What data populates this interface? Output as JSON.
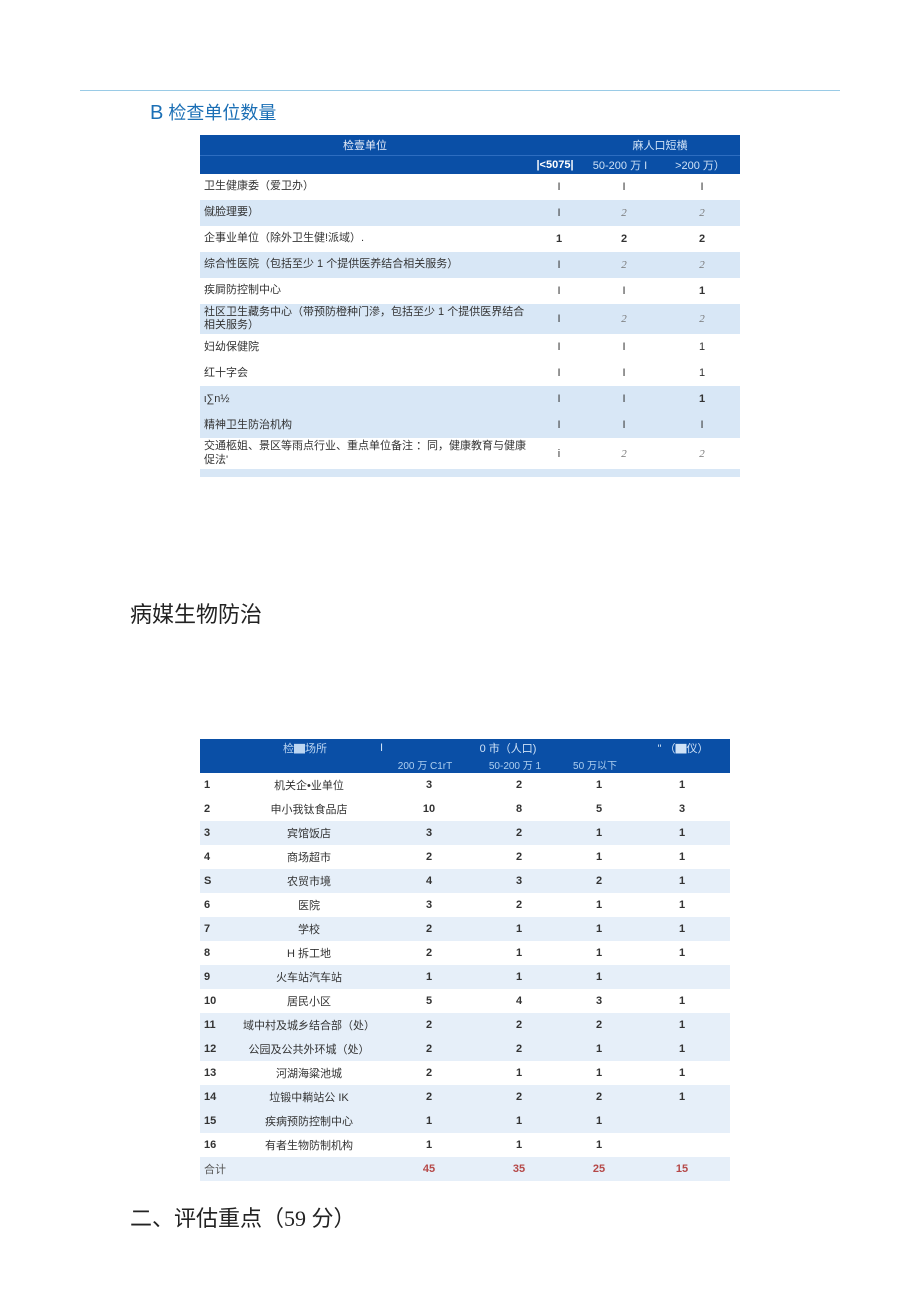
{
  "titleB": "检查单位数量",
  "titleBletter": "B",
  "table1": {
    "header": {
      "unit": "检壹单位",
      "pop": "麻人口短横",
      "c1": "|<5075|",
      "c2": "50-200 万 I",
      "c3": ">200 万）"
    },
    "rows": [
      {
        "name": "卫生健康委（爱卫办）",
        "c1": "I",
        "c2": "I",
        "c3": "I",
        "alt": false
      },
      {
        "name": "僦脸理要）",
        "c1": "I",
        "c2": "2",
        "c2i": true,
        "c3": "2",
        "c3i": true,
        "alt": true
      },
      {
        "name": "企事业单位（除外卫生健!派域）.",
        "c1": "1",
        "c1b": true,
        "c2": "2",
        "c2b": true,
        "c3": "2",
        "c3b": true,
        "alt": false
      },
      {
        "name": "综合性医院（包括至少 1 个提供医养结合相关服务）",
        "c1": "I",
        "c2": "2",
        "c2i": true,
        "c3": "2",
        "c3i": true,
        "alt": true
      },
      {
        "name": "疾屙防控制中心",
        "c1": "I",
        "c2": "I",
        "c3": "1",
        "c3b": true,
        "alt": false
      },
      {
        "name": "社区卫生藏务中心（带预防橙种门滲，包括至少 1 个提供医界结合相关服务）",
        "c1": "I",
        "c2": "2",
        "c2i": true,
        "c3": "2",
        "c3i": true,
        "alt": true
      },
      {
        "name": "妇幼保健院",
        "c1": "I",
        "c2": "I",
        "c3": "1",
        "alt": false
      },
      {
        "name": "红十字会",
        "c1": "I",
        "c2": "I",
        "c3": "1",
        "alt": false
      },
      {
        "name": "ι∑n½",
        "c1": "I",
        "c2": "I",
        "c3": "1",
        "c3b": true,
        "alt": true
      },
      {
        "name": "精神卫生防治机构",
        "c1": "I",
        "c2": "I",
        "c3": "I",
        "alt": true
      }
    ],
    "footnote": "交通柩姐、景区等雨点行业、重点单位备注 ：同，健康教育与健康促法'",
    "footc1": "i",
    "footc2": "2",
    "footc3": "2"
  },
  "sectionA": "病媒生物防治",
  "table2": {
    "header": {
      "place": "检▇场所",
      "vbar": "I",
      "city": "0 市（人口)",
      "last": "\"  （▇仪）",
      "c1": "200 万 C1rT",
      "c2": "50-200 万 1",
      "c3": "50 万以下"
    },
    "rows": [
      {
        "idx": "1",
        "place": "机关企•业单位",
        "c1": "3",
        "c2": "2",
        "c3": "1",
        "c4": "1"
      },
      {
        "idx": "2",
        "place": "申小我钛食品店",
        "c1": "10",
        "c2": "8",
        "c3": "5",
        "c4": "3"
      },
      {
        "idx": "3",
        "place": "宾馆饭店",
        "c1": "3",
        "c2": "2",
        "c3": "1",
        "c4": "1",
        "alt": true
      },
      {
        "idx": "4",
        "place": "商场超市",
        "c1": "2",
        "c2": "2",
        "c3": "1",
        "c4": "1"
      },
      {
        "idx": "S",
        "place": "农贸市境",
        "c1": "4",
        "c2": "3",
        "c3": "2",
        "c4": "1",
        "alt": true
      },
      {
        "idx": "6",
        "place": "医院",
        "c1": "3",
        "c2": "2",
        "c3": "1",
        "c4": "1"
      },
      {
        "idx": "7",
        "place": "学校",
        "c1": "2",
        "c2": "1",
        "c3": "1",
        "c4": "1",
        "alt": true
      },
      {
        "idx": "8",
        "place": "H 拆工地",
        "c1": "2",
        "c2": "1",
        "c3": "1",
        "c4": "1"
      },
      {
        "idx": "9",
        "place": "火车站汽车站",
        "c1": "1",
        "c2": "1",
        "c3": "1",
        "c4": "",
        "alt": true
      },
      {
        "idx": "10",
        "place": "居民小区",
        "c1": "5",
        "c2": "4",
        "c3": "3",
        "c4": "1"
      },
      {
        "idx": "11",
        "place": "域中村及城乡结合部（处）",
        "c1": "2",
        "c2": "2",
        "c3": "2",
        "c4": "1",
        "alt": true
      },
      {
        "idx": "12",
        "place": "公园及公共外环城（处）",
        "c1": "2",
        "c2": "2",
        "c3": "1",
        "c4": "1",
        "alt": true
      },
      {
        "idx": "13",
        "place": "河湖海粱池城",
        "c1": "2",
        "c2": "1",
        "c3": "1",
        "c4": "1"
      },
      {
        "idx": "14",
        "place": "垃锻中耥站公 IK",
        "c1": "2",
        "c2": "2",
        "c3": "2",
        "c4": "1",
        "alt": true
      },
      {
        "idx": "15",
        "place": "疾病预防控制中心",
        "c1": "1",
        "c2": "1",
        "c3": "1",
        "c4": "",
        "alt": true
      },
      {
        "idx": "16",
        "place": "有者生物防制机构",
        "c1": "1",
        "c2": "1",
        "c3": "1",
        "c4": ""
      }
    ],
    "total": {
      "label": "合计",
      "c1": "45",
      "c2": "35",
      "c3": "25",
      "c4": "15"
    }
  },
  "sectionB": "二、评估重点（59 分）"
}
